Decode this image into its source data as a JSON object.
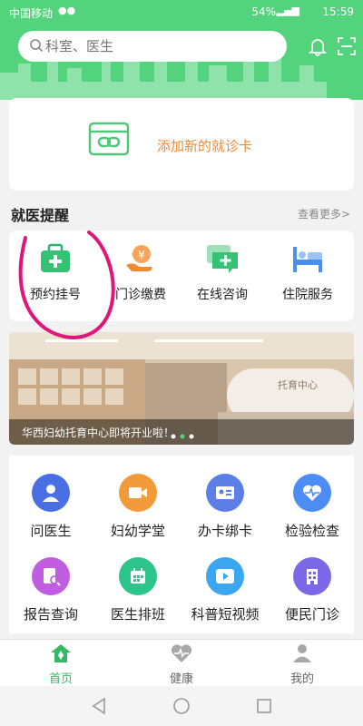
{
  "status_bar": {
    "carrier": "中国移动",
    "battery": "54%",
    "time": "15:59"
  },
  "search": {
    "placeholder": "科室、医生"
  },
  "add_card": {
    "label": "添加新的就诊卡"
  },
  "section": {
    "title": "就医提醒",
    "more": "查看更多>"
  },
  "quick_actions": [
    {
      "label": "预约挂号",
      "icon": "medical-kit-icon"
    },
    {
      "label": "门诊缴费",
      "icon": "payment-hand-icon"
    },
    {
      "label": "在线咨询",
      "icon": "chat-plus-icon"
    },
    {
      "label": "住院服务",
      "icon": "hospital-bed-icon"
    }
  ],
  "banner": {
    "caption": "华西妇幼托育中心即将开业啦！",
    "slide_count": 3,
    "active_slide": 2
  },
  "grid": [
    {
      "label": "问医生",
      "icon": "doctor-icon",
      "color": "#4a6fe3"
    },
    {
      "label": "妇幼学堂",
      "icon": "video-camera-icon",
      "color": "#f39a3a"
    },
    {
      "label": "办卡绑卡",
      "icon": "id-card-icon",
      "color": "#5b7fe6"
    },
    {
      "label": "检验检查",
      "icon": "heart-pulse-icon",
      "color": "#4c8df5"
    },
    {
      "label": "报告查询",
      "icon": "report-search-icon",
      "color": "#c05de0"
    },
    {
      "label": "医生排班",
      "icon": "calendar-icon",
      "color": "#2ec48d"
    },
    {
      "label": "科普短视频",
      "icon": "play-video-icon",
      "color": "#3aa7f0"
    },
    {
      "label": "便民门诊",
      "icon": "building-icon",
      "color": "#7b68e8"
    }
  ],
  "tabs": [
    {
      "label": "首页",
      "icon": "home-icon",
      "active": true
    },
    {
      "label": "健康",
      "icon": "heart-icon",
      "active": false
    },
    {
      "label": "我的",
      "icon": "user-icon",
      "active": false
    }
  ],
  "colors": {
    "brand": "#53d47c",
    "accent_orange": "#f08a2c",
    "annotation": "#e0167a"
  }
}
